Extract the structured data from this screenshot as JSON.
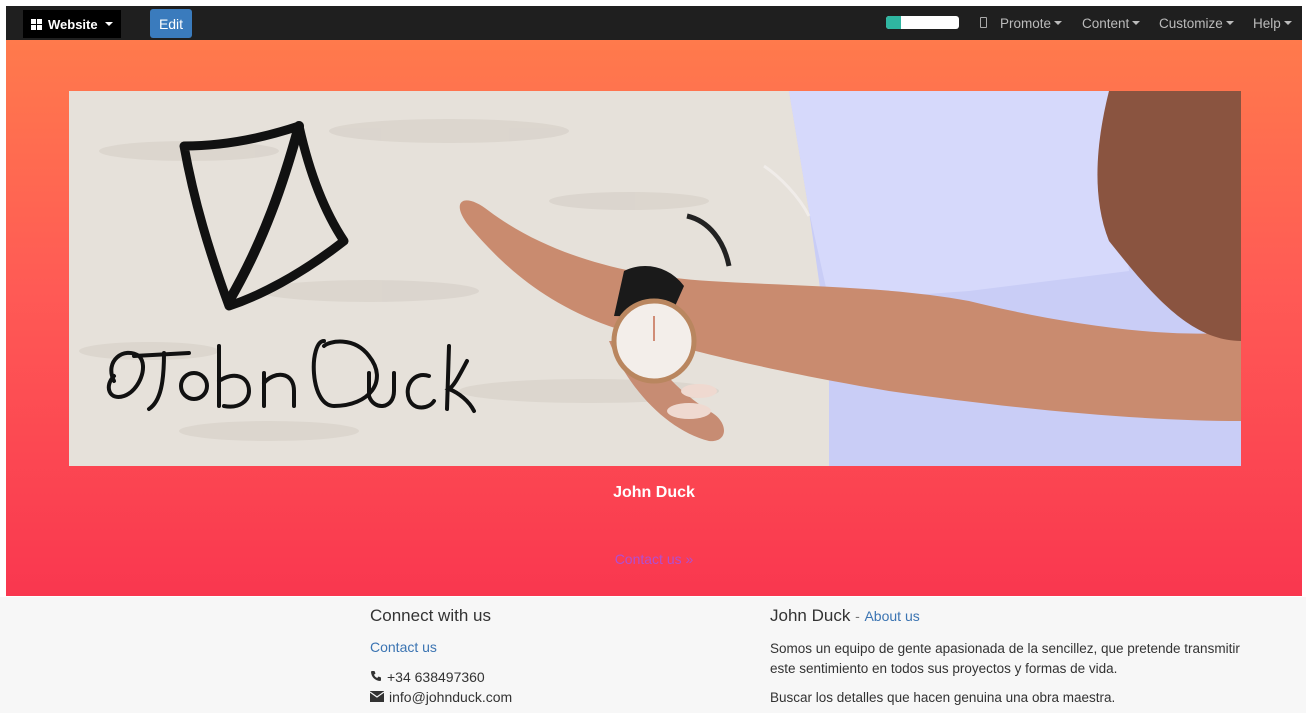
{
  "topbar": {
    "website_label": "Website",
    "edit_label": "Edit",
    "progress_fraction": 0.2,
    "menus": [
      "Promote",
      "Content",
      "Customize",
      "Help"
    ]
  },
  "hero": {
    "title": "John Duck",
    "cta": "Contact us »",
    "logo_text": "John Duck"
  },
  "footer": {
    "connect": {
      "heading": "Connect with us",
      "contact_link": "Contact us",
      "phone": "+34 638497360",
      "email": "info@johnduck.com"
    },
    "about": {
      "name": "John Duck",
      "sep": "-",
      "about_link": "About us",
      "paragraph": "Somos un equipo de gente apasionada de la sencillez, que pretende transmitir este sentimiento en todos sus proyectos y formas de vida.",
      "paragraph2": "Buscar los detalles que hacen genuina una obra maestra."
    }
  },
  "colors": {
    "hero_top": "#ff7a4c",
    "hero_bottom": "#f9374f",
    "edit_button": "#3a7bbd",
    "link": "#3b74b2",
    "progress": "#2fb6a1"
  }
}
